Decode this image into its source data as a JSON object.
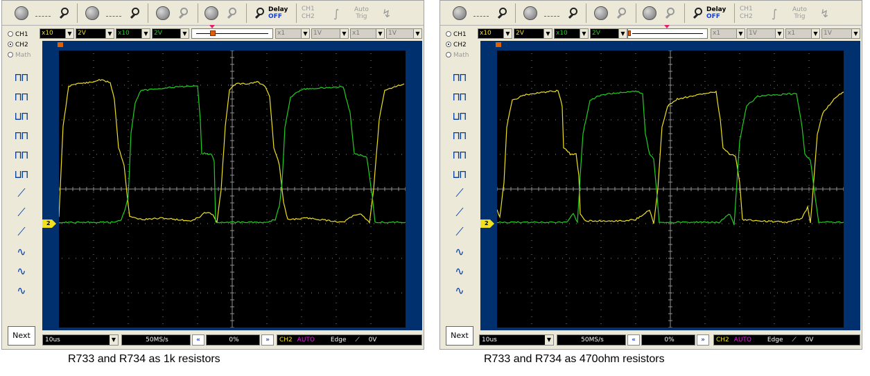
{
  "panels": [
    {
      "toolbar": {
        "delay_label": "Delay",
        "delay_value": "OFF",
        "ch1": "CH1",
        "ch2": "CH2",
        "auto_label": "Auto",
        "trig_label": "Trig"
      },
      "channels": {
        "ch1": "CH1",
        "ch2": "CH2",
        "math": "Math",
        "selected": "CH2"
      },
      "ch1": {
        "probe": "x10",
        "volts": "2V"
      },
      "ch2": {
        "probe": "x10",
        "volts": "2V"
      },
      "math1": {
        "probe": "x1",
        "volts": "1V"
      },
      "math2": {
        "probe": "x1",
        "volts": "1V"
      },
      "next_label": "Next",
      "timebase": "10us",
      "samplerate": "50MS/s",
      "position": "0%",
      "trigger": {
        "source": "CH2",
        "mode": "AUTO",
        "type": "Edge",
        "level": "0V"
      },
      "ch2_marker": "2",
      "caption": "R733 and R734 as 1k resistors"
    },
    {
      "toolbar": {
        "delay_label": "Delay",
        "delay_value": "OFF",
        "ch1": "CH1",
        "ch2": "CH2",
        "auto_label": "Auto",
        "trig_label": "Trig"
      },
      "channels": {
        "ch1": "CH1",
        "ch2": "CH2",
        "math": "Math",
        "selected": "CH2"
      },
      "ch1": {
        "probe": "x10",
        "volts": "2V"
      },
      "ch2": {
        "probe": "x10",
        "volts": "2V"
      },
      "math1": {
        "probe": "x1",
        "volts": "1V"
      },
      "math2": {
        "probe": "x1",
        "volts": "1V"
      },
      "next_label": "Next",
      "timebase": "10us",
      "samplerate": "50MS/s",
      "position": "0%",
      "trigger": {
        "source": "CH2",
        "mode": "AUTO",
        "type": "Edge",
        "level": "0V"
      },
      "ch2_marker": "2",
      "caption": "R733 and R734 as 470ohm resistors"
    }
  ],
  "colors": {
    "ch1_trace": "#f0e020",
    "ch2_trace": "#20d020",
    "grid": "#909090",
    "screen_bg": "#000000",
    "frame": "#00306e"
  }
}
